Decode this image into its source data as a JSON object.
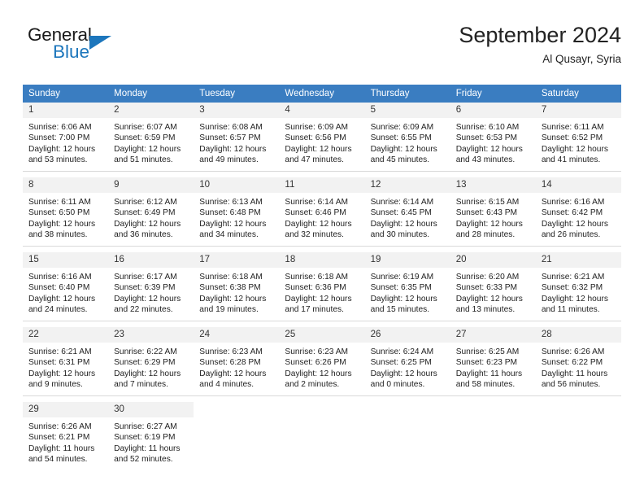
{
  "brand": {
    "name_top": "General",
    "name_bottom": "Blue",
    "triangle_color": "#1c76bc",
    "accent_color": "#1c76bc"
  },
  "header": {
    "title": "September 2024",
    "subtitle": "Al Qusayr, Syria"
  },
  "theme": {
    "header_row_bg": "#3a7dc1",
    "header_row_text": "#ffffff",
    "daynum_bg": "#f2f2f2",
    "cell_bg": "#ffffff",
    "divider": "#d9d9d9"
  },
  "weekday_headers": [
    "Sunday",
    "Monday",
    "Tuesday",
    "Wednesday",
    "Thursday",
    "Friday",
    "Saturday"
  ],
  "weeks": [
    {
      "days": [
        {
          "num": "1",
          "sunrise": "Sunrise: 6:06 AM",
          "sunset": "Sunset: 7:00 PM",
          "daylight_line1": "Daylight: 12 hours",
          "daylight_line2": "and 53 minutes."
        },
        {
          "num": "2",
          "sunrise": "Sunrise: 6:07 AM",
          "sunset": "Sunset: 6:59 PM",
          "daylight_line1": "Daylight: 12 hours",
          "daylight_line2": "and 51 minutes."
        },
        {
          "num": "3",
          "sunrise": "Sunrise: 6:08 AM",
          "sunset": "Sunset: 6:57 PM",
          "daylight_line1": "Daylight: 12 hours",
          "daylight_line2": "and 49 minutes."
        },
        {
          "num": "4",
          "sunrise": "Sunrise: 6:09 AM",
          "sunset": "Sunset: 6:56 PM",
          "daylight_line1": "Daylight: 12 hours",
          "daylight_line2": "and 47 minutes."
        },
        {
          "num": "5",
          "sunrise": "Sunrise: 6:09 AM",
          "sunset": "Sunset: 6:55 PM",
          "daylight_line1": "Daylight: 12 hours",
          "daylight_line2": "and 45 minutes."
        },
        {
          "num": "6",
          "sunrise": "Sunrise: 6:10 AM",
          "sunset": "Sunset: 6:53 PM",
          "daylight_line1": "Daylight: 12 hours",
          "daylight_line2": "and 43 minutes."
        },
        {
          "num": "7",
          "sunrise": "Sunrise: 6:11 AM",
          "sunset": "Sunset: 6:52 PM",
          "daylight_line1": "Daylight: 12 hours",
          "daylight_line2": "and 41 minutes."
        }
      ]
    },
    {
      "days": [
        {
          "num": "8",
          "sunrise": "Sunrise: 6:11 AM",
          "sunset": "Sunset: 6:50 PM",
          "daylight_line1": "Daylight: 12 hours",
          "daylight_line2": "and 38 minutes."
        },
        {
          "num": "9",
          "sunrise": "Sunrise: 6:12 AM",
          "sunset": "Sunset: 6:49 PM",
          "daylight_line1": "Daylight: 12 hours",
          "daylight_line2": "and 36 minutes."
        },
        {
          "num": "10",
          "sunrise": "Sunrise: 6:13 AM",
          "sunset": "Sunset: 6:48 PM",
          "daylight_line1": "Daylight: 12 hours",
          "daylight_line2": "and 34 minutes."
        },
        {
          "num": "11",
          "sunrise": "Sunrise: 6:14 AM",
          "sunset": "Sunset: 6:46 PM",
          "daylight_line1": "Daylight: 12 hours",
          "daylight_line2": "and 32 minutes."
        },
        {
          "num": "12",
          "sunrise": "Sunrise: 6:14 AM",
          "sunset": "Sunset: 6:45 PM",
          "daylight_line1": "Daylight: 12 hours",
          "daylight_line2": "and 30 minutes."
        },
        {
          "num": "13",
          "sunrise": "Sunrise: 6:15 AM",
          "sunset": "Sunset: 6:43 PM",
          "daylight_line1": "Daylight: 12 hours",
          "daylight_line2": "and 28 minutes."
        },
        {
          "num": "14",
          "sunrise": "Sunrise: 6:16 AM",
          "sunset": "Sunset: 6:42 PM",
          "daylight_line1": "Daylight: 12 hours",
          "daylight_line2": "and 26 minutes."
        }
      ]
    },
    {
      "days": [
        {
          "num": "15",
          "sunrise": "Sunrise: 6:16 AM",
          "sunset": "Sunset: 6:40 PM",
          "daylight_line1": "Daylight: 12 hours",
          "daylight_line2": "and 24 minutes."
        },
        {
          "num": "16",
          "sunrise": "Sunrise: 6:17 AM",
          "sunset": "Sunset: 6:39 PM",
          "daylight_line1": "Daylight: 12 hours",
          "daylight_line2": "and 22 minutes."
        },
        {
          "num": "17",
          "sunrise": "Sunrise: 6:18 AM",
          "sunset": "Sunset: 6:38 PM",
          "daylight_line1": "Daylight: 12 hours",
          "daylight_line2": "and 19 minutes."
        },
        {
          "num": "18",
          "sunrise": "Sunrise: 6:18 AM",
          "sunset": "Sunset: 6:36 PM",
          "daylight_line1": "Daylight: 12 hours",
          "daylight_line2": "and 17 minutes."
        },
        {
          "num": "19",
          "sunrise": "Sunrise: 6:19 AM",
          "sunset": "Sunset: 6:35 PM",
          "daylight_line1": "Daylight: 12 hours",
          "daylight_line2": "and 15 minutes."
        },
        {
          "num": "20",
          "sunrise": "Sunrise: 6:20 AM",
          "sunset": "Sunset: 6:33 PM",
          "daylight_line1": "Daylight: 12 hours",
          "daylight_line2": "and 13 minutes."
        },
        {
          "num": "21",
          "sunrise": "Sunrise: 6:21 AM",
          "sunset": "Sunset: 6:32 PM",
          "daylight_line1": "Daylight: 12 hours",
          "daylight_line2": "and 11 minutes."
        }
      ]
    },
    {
      "days": [
        {
          "num": "22",
          "sunrise": "Sunrise: 6:21 AM",
          "sunset": "Sunset: 6:31 PM",
          "daylight_line1": "Daylight: 12 hours",
          "daylight_line2": "and 9 minutes."
        },
        {
          "num": "23",
          "sunrise": "Sunrise: 6:22 AM",
          "sunset": "Sunset: 6:29 PM",
          "daylight_line1": "Daylight: 12 hours",
          "daylight_line2": "and 7 minutes."
        },
        {
          "num": "24",
          "sunrise": "Sunrise: 6:23 AM",
          "sunset": "Sunset: 6:28 PM",
          "daylight_line1": "Daylight: 12 hours",
          "daylight_line2": "and 4 minutes."
        },
        {
          "num": "25",
          "sunrise": "Sunrise: 6:23 AM",
          "sunset": "Sunset: 6:26 PM",
          "daylight_line1": "Daylight: 12 hours",
          "daylight_line2": "and 2 minutes."
        },
        {
          "num": "26",
          "sunrise": "Sunrise: 6:24 AM",
          "sunset": "Sunset: 6:25 PM",
          "daylight_line1": "Daylight: 12 hours",
          "daylight_line2": "and 0 minutes."
        },
        {
          "num": "27",
          "sunrise": "Sunrise: 6:25 AM",
          "sunset": "Sunset: 6:23 PM",
          "daylight_line1": "Daylight: 11 hours",
          "daylight_line2": "and 58 minutes."
        },
        {
          "num": "28",
          "sunrise": "Sunrise: 6:26 AM",
          "sunset": "Sunset: 6:22 PM",
          "daylight_line1": "Daylight: 11 hours",
          "daylight_line2": "and 56 minutes."
        }
      ]
    },
    {
      "days": [
        {
          "num": "29",
          "sunrise": "Sunrise: 6:26 AM",
          "sunset": "Sunset: 6:21 PM",
          "daylight_line1": "Daylight: 11 hours",
          "daylight_line2": "and 54 minutes."
        },
        {
          "num": "30",
          "sunrise": "Sunrise: 6:27 AM",
          "sunset": "Sunset: 6:19 PM",
          "daylight_line1": "Daylight: 11 hours",
          "daylight_line2": "and 52 minutes."
        },
        {
          "num": "",
          "sunrise": "",
          "sunset": "",
          "daylight_line1": "",
          "daylight_line2": ""
        },
        {
          "num": "",
          "sunrise": "",
          "sunset": "",
          "daylight_line1": "",
          "daylight_line2": ""
        },
        {
          "num": "",
          "sunrise": "",
          "sunset": "",
          "daylight_line1": "",
          "daylight_line2": ""
        },
        {
          "num": "",
          "sunrise": "",
          "sunset": "",
          "daylight_line1": "",
          "daylight_line2": ""
        },
        {
          "num": "",
          "sunrise": "",
          "sunset": "",
          "daylight_line1": "",
          "daylight_line2": ""
        }
      ]
    }
  ]
}
